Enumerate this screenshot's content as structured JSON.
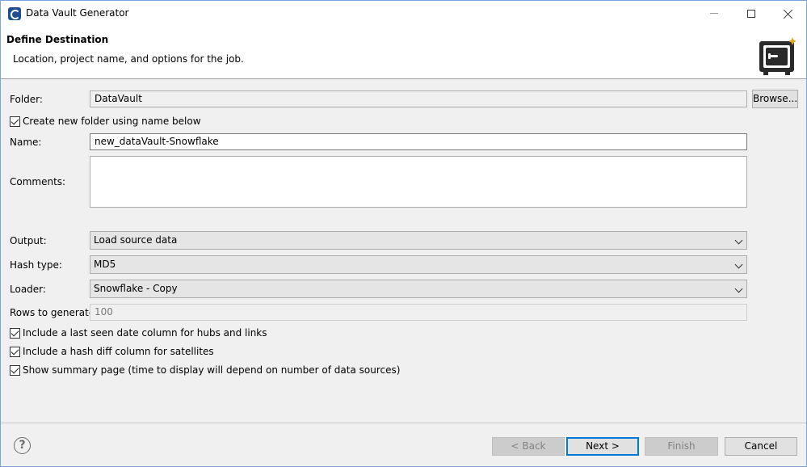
{
  "window": {
    "title": "Data Vault Generator"
  },
  "banner": {
    "title": "Define Destination",
    "description": "Location, project name, and options for the job."
  },
  "form": {
    "folder_label": "Folder:",
    "folder_value": "DataVault",
    "browse_label": "Browse...",
    "create_folder_label": "Create new folder using name below",
    "create_folder_checked": true,
    "name_label": "Name:",
    "name_value": "new_dataVault-Snowflake",
    "comments_label": "Comments:",
    "comments_value": "",
    "output_label": "Output:",
    "output_value": "Load source data",
    "hash_label": "Hash type:",
    "hash_value": "MD5",
    "loader_label": "Loader:",
    "loader_value": "Snowflake - Copy",
    "rows_label": "Rows to generate:",
    "rows_value": "100",
    "options": [
      {
        "label": "Include a last seen date column for hubs and links",
        "checked": true
      },
      {
        "label": "Include a hash diff column for satellites",
        "checked": true
      },
      {
        "label": "Show summary page (time to display will depend on number of data sources)",
        "checked": true
      }
    ]
  },
  "footer": {
    "help_glyph": "?",
    "back_label": "< Back",
    "next_label": "Next >",
    "finish_label": "Finish",
    "cancel_label": "Cancel"
  },
  "colors": {
    "accent": "#0078d7",
    "window_border": "#7aa7d8"
  }
}
